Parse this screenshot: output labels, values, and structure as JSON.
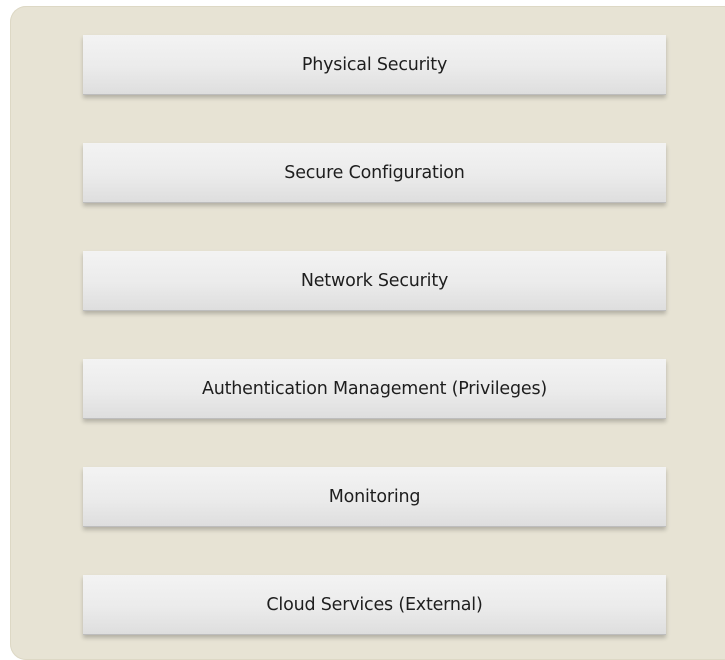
{
  "layers": [
    {
      "label": "Physical Security"
    },
    {
      "label": "Secure Configuration"
    },
    {
      "label": "Network Security"
    },
    {
      "label": "Authentication Management (Privileges)"
    },
    {
      "label": "Monitoring"
    },
    {
      "label": "Cloud Services (External)"
    }
  ],
  "colors": {
    "background_panel": "#e7e3d4",
    "layer_box": "#ebebeb",
    "text": "#1e1e1e"
  }
}
